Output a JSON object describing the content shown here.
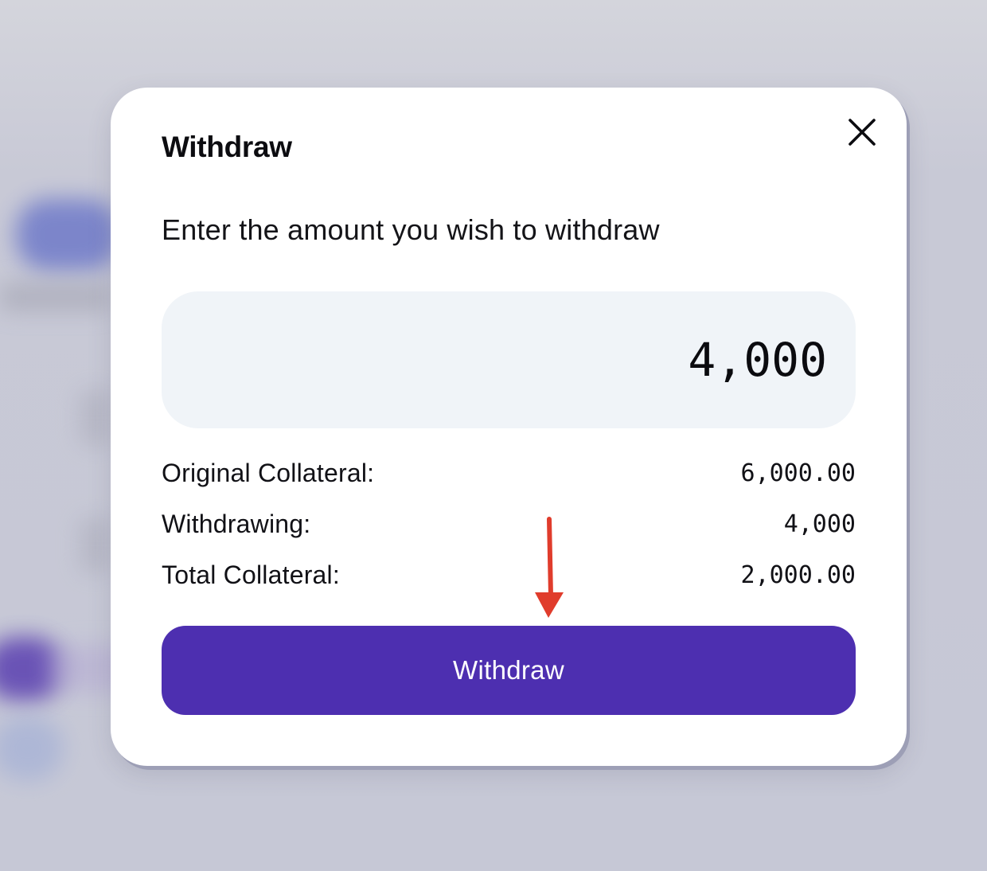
{
  "modal": {
    "title": "Withdraw",
    "prompt": "Enter the amount you wish to withdraw",
    "amount_input": {
      "value": "4,000",
      "placeholder": ""
    },
    "summary": [
      {
        "label": "Original Collateral:",
        "value": "6,000.00"
      },
      {
        "label": "Withdrawing:",
        "value": "4,000"
      },
      {
        "label": "Total Collateral:",
        "value": "2,000.00"
      }
    ],
    "submit_label": "Withdraw",
    "close_icon": "close-icon"
  },
  "colors": {
    "primary_button": "#4d2fb0",
    "input_background": "#f0f4f8",
    "annotation_arrow": "#e03c2c"
  }
}
